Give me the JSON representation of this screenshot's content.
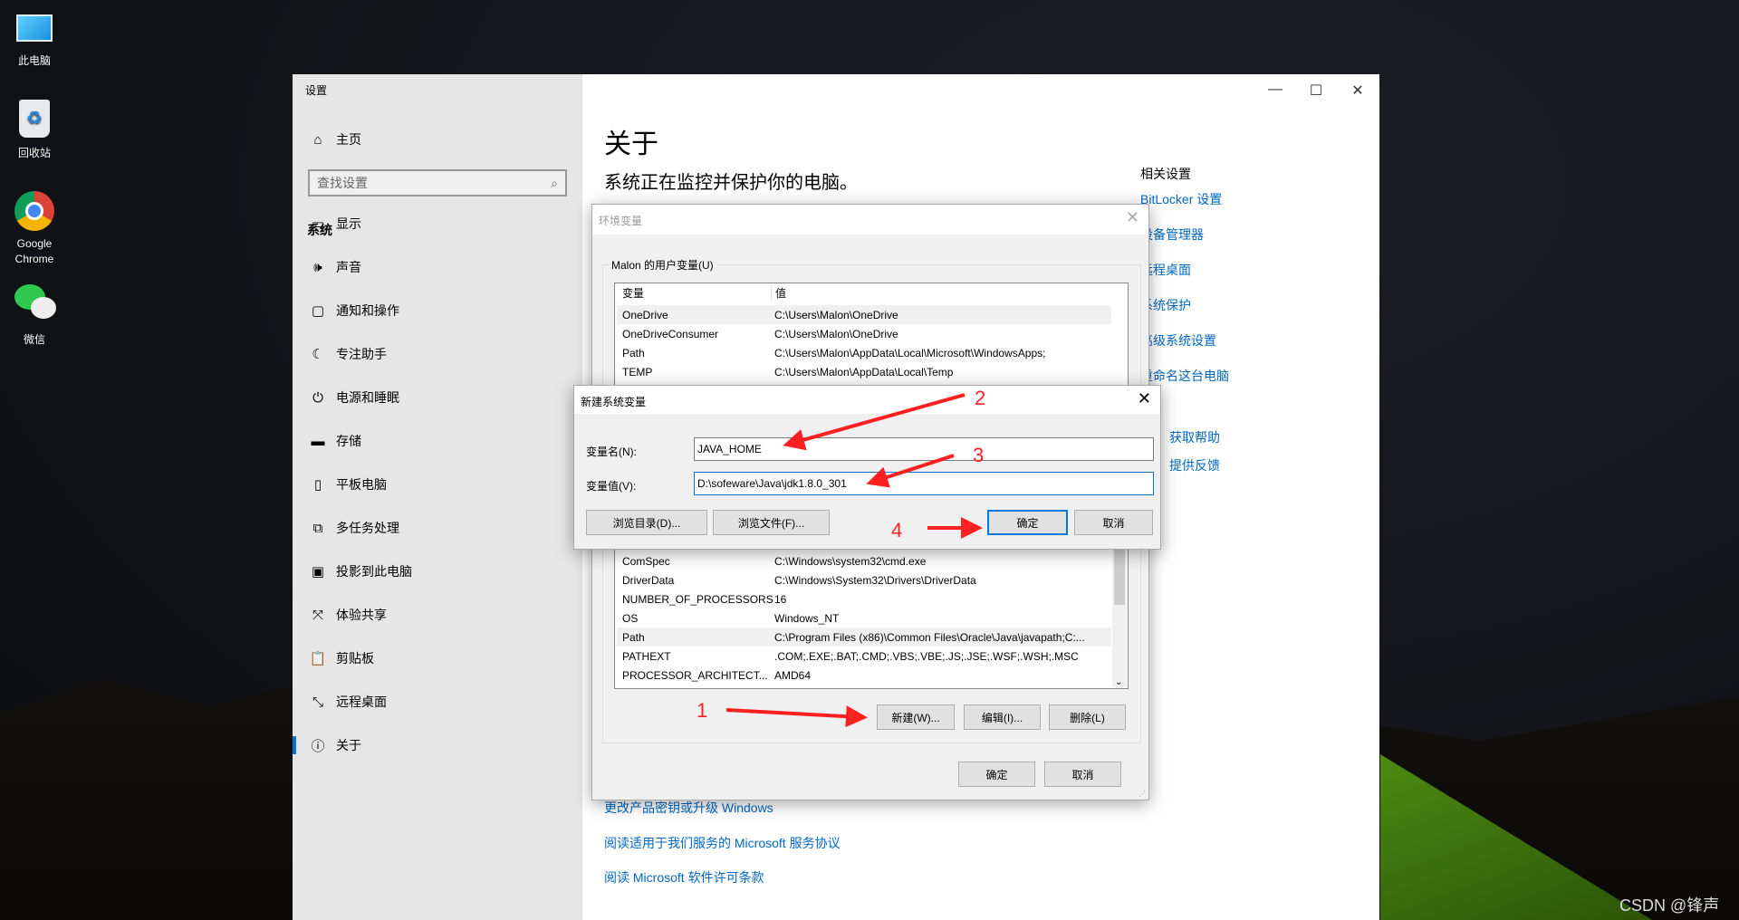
{
  "desktop": {
    "icons": [
      {
        "label": "此电脑",
        "icon": "computer-icon"
      },
      {
        "label": "回收站",
        "icon": "recycle-bin-icon"
      },
      {
        "label": "Google Chrome",
        "icon": "chrome-icon"
      },
      {
        "label": "微信",
        "icon": "wechat-icon"
      }
    ],
    "watermark": "CSDN @锋声"
  },
  "settings": {
    "window_title": "设置",
    "home": "主页",
    "search_placeholder": "查找设置",
    "group": "系统",
    "nav": [
      {
        "label": "显示",
        "icon": "display-icon"
      },
      {
        "label": "声音",
        "icon": "sound-icon"
      },
      {
        "label": "通知和操作",
        "icon": "notification-icon"
      },
      {
        "label": "专注助手",
        "icon": "moon-icon"
      },
      {
        "label": "电源和睡眠",
        "icon": "power-icon"
      },
      {
        "label": "存储",
        "icon": "storage-icon"
      },
      {
        "label": "平板电脑",
        "icon": "tablet-icon"
      },
      {
        "label": "多任务处理",
        "icon": "multitask-icon"
      },
      {
        "label": "投影到此电脑",
        "icon": "project-icon"
      },
      {
        "label": "体验共享",
        "icon": "share-icon"
      },
      {
        "label": "剪贴板",
        "icon": "clipboard-icon"
      },
      {
        "label": "远程桌面",
        "icon": "remote-icon"
      },
      {
        "label": "关于",
        "icon": "info-icon",
        "selected": true
      }
    ],
    "main": {
      "title": "关于",
      "subtitle": "系统正在监控并保护你的电脑。",
      "related_heading": "相关设置",
      "related_links": [
        "BitLocker 设置",
        "设备管理器",
        "远程桌面",
        "系统保护",
        "高级系统设置",
        "重命名这台电脑"
      ],
      "help_links": [
        "获取帮助",
        "提供反馈"
      ],
      "bottom_links": [
        "更改产品密钥或升级 Windows",
        "阅读适用于我们服务的 Microsoft 服务协议",
        "阅读 Microsoft 软件许可条款"
      ]
    },
    "accent": "#0078d7"
  },
  "env_dialog": {
    "title": "环境变量",
    "user_group": "Malon 的用户变量(U)",
    "col_var": "变量",
    "col_val": "值",
    "user_vars": [
      {
        "name": "OneDrive",
        "value": "C:\\Users\\Malon\\OneDrive"
      },
      {
        "name": "OneDriveConsumer",
        "value": "C:\\Users\\Malon\\OneDrive"
      },
      {
        "name": "Path",
        "value": "C:\\Users\\Malon\\AppData\\Local\\Microsoft\\WindowsApps;"
      },
      {
        "name": "TEMP",
        "value": "C:\\Users\\Malon\\AppData\\Local\\Temp"
      }
    ],
    "system_vars": [
      {
        "name": "ComSpec",
        "value": "C:\\Windows\\system32\\cmd.exe"
      },
      {
        "name": "DriverData",
        "value": "C:\\Windows\\System32\\Drivers\\DriverData"
      },
      {
        "name": "NUMBER_OF_PROCESSORS",
        "value": "16"
      },
      {
        "name": "OS",
        "value": "Windows_NT"
      },
      {
        "name": "Path",
        "value": "C:\\Program Files (x86)\\Common Files\\Oracle\\Java\\javapath;C:..."
      },
      {
        "name": "PATHEXT",
        "value": ".COM;.EXE;.BAT;.CMD;.VBS;.VBE;.JS;.JSE;.WSF;.WSH;.MSC"
      },
      {
        "name": "PROCESSOR_ARCHITECT...",
        "value": "AMD64"
      }
    ],
    "new_btn": "新建(W)...",
    "edit_btn": "编辑(I)...",
    "delete_btn": "删除(L)",
    "ok": "确定",
    "cancel": "取消"
  },
  "new_var_dialog": {
    "title": "新建系统变量",
    "name_label": "变量名(N):",
    "name_value": "JAVA_HOME",
    "value_label": "变量值(V):",
    "value_value": "D:\\sofeware\\Java\\jdk1.8.0_301",
    "browse_dir": "浏览目录(D)...",
    "browse_file": "浏览文件(F)...",
    "ok": "确定",
    "cancel": "取消"
  },
  "annotations": {
    "color": "#ff2020",
    "steps": [
      "1",
      "2",
      "3",
      "4"
    ]
  }
}
